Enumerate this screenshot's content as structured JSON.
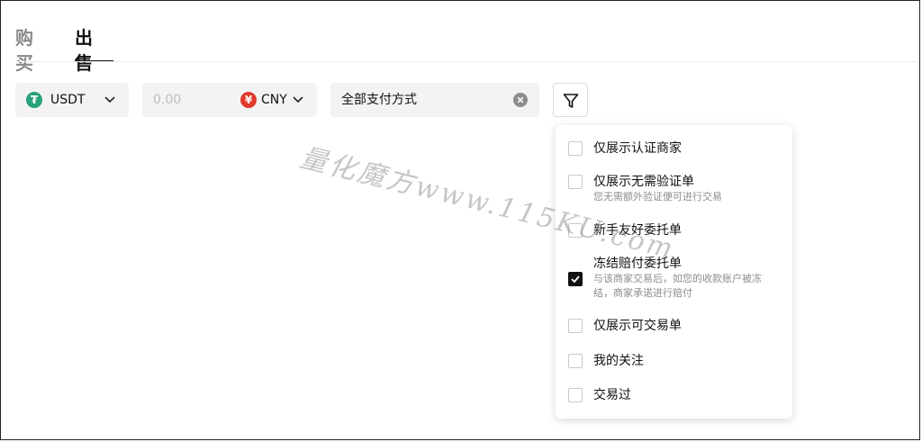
{
  "tabs": [
    {
      "label": "购买",
      "active": false
    },
    {
      "label": "出售",
      "active": true
    }
  ],
  "filters": {
    "coin": {
      "label": "USDT",
      "icon": "tether-icon"
    },
    "amount": {
      "placeholder": "0.00",
      "currency": "CNY",
      "currency_icon": "cny-icon"
    },
    "payment": {
      "label": "全部支付方式"
    }
  },
  "dropdown": {
    "options": [
      {
        "label": "仅展示认证商家",
        "desc": "",
        "checked": false
      },
      {
        "label": "仅展示无需验证单",
        "desc": "您无需额外验证便可进行交易",
        "checked": false
      },
      {
        "label": "新手友好委托单",
        "desc": "",
        "checked": false
      },
      {
        "label": "冻结赔付委托单",
        "desc": "与该商家交易后，如您的收款账户被冻结，商家承诺进行赔付",
        "checked": true
      },
      {
        "label": "仅展示可交易单",
        "desc": "",
        "checked": false
      },
      {
        "label": "我的关注",
        "desc": "",
        "checked": false
      },
      {
        "label": "交易过",
        "desc": "",
        "checked": false
      }
    ]
  },
  "watermark": {
    "text": "量化魔方www.115KU.com"
  },
  "colors": {
    "tether": "#26a17b",
    "cny": "#e0392b",
    "active_text": "#111111",
    "inactive_text": "#8a8a8a"
  }
}
